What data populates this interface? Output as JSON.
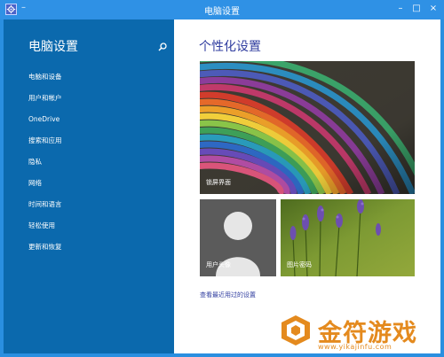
{
  "window": {
    "title": "电脑设置",
    "menu_symbol": "–",
    "controls": {
      "minimize": "–",
      "maximize": "□",
      "close": "×"
    }
  },
  "sidebar": {
    "heading": "电脑设置",
    "items": [
      {
        "label": "电脑和设备"
      },
      {
        "label": "用户和帐户"
      },
      {
        "label": "OneDrive"
      },
      {
        "label": "搜索和应用"
      },
      {
        "label": "隐私"
      },
      {
        "label": "网络"
      },
      {
        "label": "时间和语言"
      },
      {
        "label": "轻松使用"
      },
      {
        "label": "更新和恢复"
      }
    ]
  },
  "main": {
    "heading": "个性化设置",
    "tiles": {
      "lock_screen": "锁屏界面",
      "account_picture": "用户头像",
      "picture_password": "图片密码"
    },
    "recent_link": "查看最近用过的设置"
  },
  "watermark": {
    "brand": "金符游戏",
    "url": "www.yikajinfu.com"
  },
  "colors": {
    "titlebar": "#2f91e5",
    "sidebar": "#0b69ad",
    "heading_text": "#2f3c9f",
    "watermark": "#e48a1e"
  },
  "icons": [
    "settings-app-icon",
    "search-icon",
    "minimize-icon",
    "maximize-icon",
    "close-icon",
    "watermark-logo-icon"
  ]
}
